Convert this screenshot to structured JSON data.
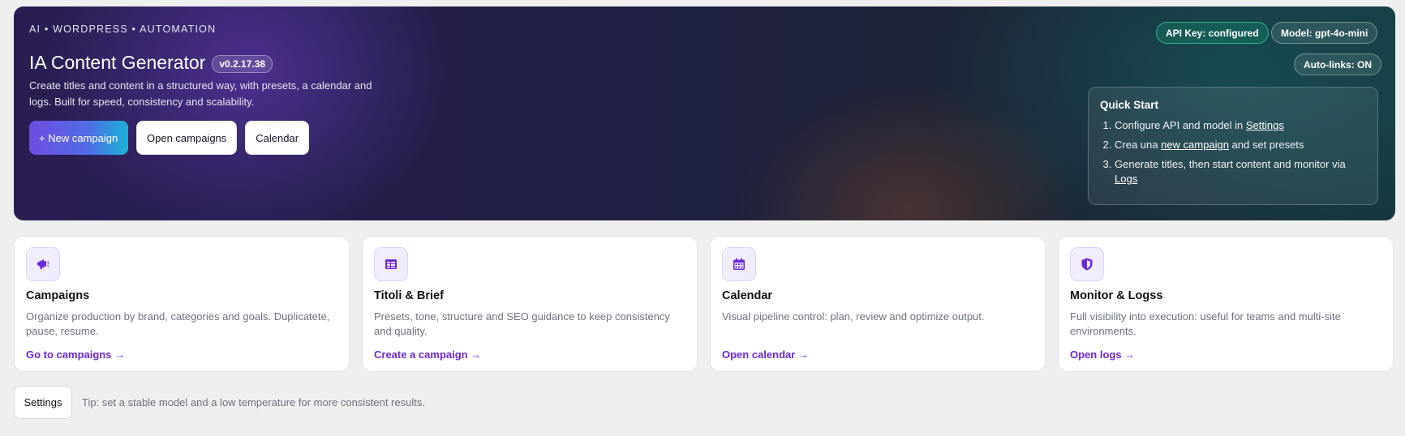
{
  "hero": {
    "eyebrow": "AI • WORDPRESS • AUTOMATION",
    "title": "IA Content Generator",
    "version": "v0.2.17.38",
    "description": "Create titles and content in a structured way, with presets, a calendar and logs. Built for speed, consistency and scalability.",
    "buttons": {
      "new_campaign": "+ New campaign",
      "open_campaigns": "Open campaigns",
      "calendar": "Calendar"
    },
    "pills": {
      "api_key": "API Key: configured",
      "model": "Model: gpt-4o-mini",
      "autolinks": "Auto-links: ON"
    },
    "quick_start": {
      "title": "Quick Start",
      "step1_text": "Configure API and model in ",
      "step1_link": "Settings",
      "step2_text": "Crea una ",
      "step2_link": "new campaign",
      "step2_suffix": " and set presets",
      "step3_text": "Generate titles, then start content and monitor via ",
      "step3_link": "Logs"
    }
  },
  "cards": [
    {
      "icon": "megaphone-icon",
      "title": "Campaigns",
      "description": "Organize production by brand, categories and goals. Duplicatete, pause, resume.",
      "link": "Go to campaigns →"
    },
    {
      "icon": "table-icon",
      "title": "Titoli & Brief",
      "description": "Presets, tone, structure and SEO guidance to keep consistency and quality.",
      "link": "Create a campaign →"
    },
    {
      "icon": "calendar-icon",
      "title": "Calendar",
      "description": "Visual pipeline control: plan, review and optimize output.",
      "link": "Open calendar →"
    },
    {
      "icon": "shield-icon",
      "title": "Monitor & Logss",
      "description": "Full visibility into execution: useful for teams and multi-site environments.",
      "link": "Open logs →"
    }
  ],
  "footer": {
    "settings_label": "Settings",
    "tip": "Tip: set a stable model and a low temperature for more consistent results."
  },
  "colors": {
    "accent": "#6d28d9",
    "hero_dark": "#1e1f42",
    "pill_ok": "#3cd2a0"
  }
}
